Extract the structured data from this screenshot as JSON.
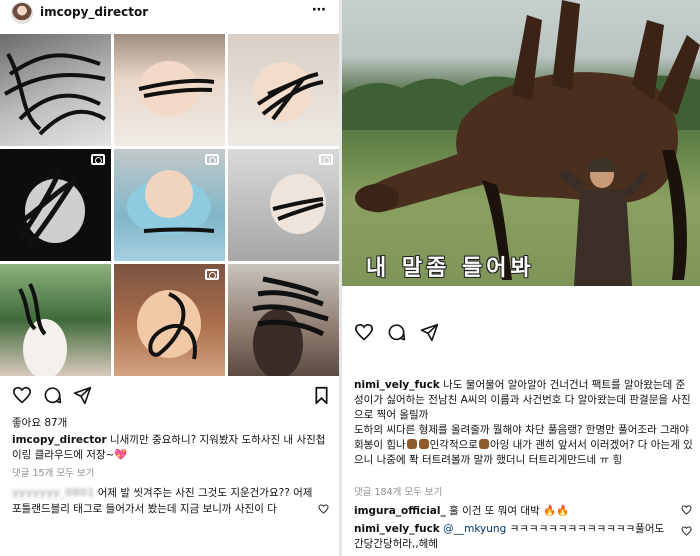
{
  "left_post": {
    "username": "imcopy_director",
    "more_icon": "⋯",
    "likes": "좋아요 87개",
    "caption_user": "imcopy_director",
    "caption_text": "니새끼만 중요하니? 지워봤자 도하사진 내 사진첩이링 클라우드에 저장~",
    "caption_emoji": "💖",
    "view_comments": "댓글 15개 모두 보기",
    "comment_user": "yyyyyyy_0801",
    "comment_text": "어제 발 씻겨주는 사진 그것도 지운건가요?? 어제 포틀랜드블리 태그로 들어가서 봤는데 지금 보니까 사진이 다",
    "grid_icons": [
      "camera-icon",
      "camera-icon",
      "camera-icon",
      "camera-icon"
    ]
  },
  "right_post": {
    "image_caption": "내 말좀 들어봐",
    "caption_user": "nimi_vely_fuck",
    "caption_text_1": "나도 물어물어 알아알아 건너건너 팩트를 알아왔는데 준성이가 싫어하는 전남친 A씨의 이름과 사건번호 다 알아왔는데 판결문을 사진으로 찍어 올릴까",
    "caption_text_2a": "도하의 씨다른 형제를 올려줄까 뭘해야 차단 풀음랭? 한명만 풀어조라 그래야 회봉이 힘나",
    "caption_text_2b": "인각적으로",
    "caption_text_2c": "아잉 내가 괜히 앞서서 이러겠어? 다 아는게 있으니 나중에 퐉 터트려볼까 말까 했더니 터트리게만드네 ㅠ 힝",
    "view_comments": "댓글 184개 모두 보기",
    "comment1_user": "imgura_official_",
    "comment1_text": "훌 이건 또 뭐여 대박",
    "comment1_emoji": "🔥🔥",
    "comment2_user": "nimi_vely_fuck",
    "comment2_mention": "@__mkyung",
    "comment2_text": "ㅋㅋㅋㅋㅋㅋㅋㅋㅋㅋㅋㅋㅋ풀어도 간당간당허라,,헤헤"
  },
  "colors": {
    "text": "#111111",
    "muted": "#8e8e8e",
    "mention": "#00376b",
    "heart_emoji": "#e0559a"
  }
}
